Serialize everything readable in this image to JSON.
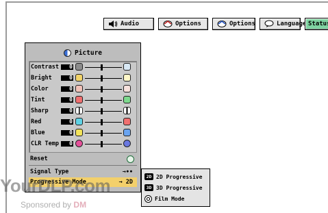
{
  "tabs": [
    {
      "label": "Audio",
      "icon": "speaker-icon",
      "active": false
    },
    {
      "label": "Options",
      "icon": "options-icon",
      "active": false
    },
    {
      "label": "Options",
      "icon": "options-icon",
      "active": false
    },
    {
      "label": "Language",
      "icon": "speech-bubble-icon",
      "active": false
    },
    {
      "label": "Status",
      "icon": "",
      "active": true
    }
  ],
  "panel": {
    "title": "Picture",
    "adjustments": [
      {
        "label": "Contrast",
        "value": "0",
        "left_color": "#8c8c8c",
        "right_color": "#d8e8f4"
      },
      {
        "label": "Bright",
        "value": "0",
        "left_color": "#f1d36a",
        "right_color": "#fff7c8"
      },
      {
        "label": "Color",
        "value": "0",
        "left_color": "#f1c2b8",
        "right_color": "#f7e1dc"
      },
      {
        "label": "Tint",
        "value": "0",
        "left_color": "#f07070",
        "right_color": "#7ed98e"
      },
      {
        "label": "Sharp",
        "value": "0",
        "left_color": "#ffffff",
        "right_color": "#ffffff"
      },
      {
        "label": "Red",
        "value": "0",
        "left_color": "#5fd3e6",
        "right_color": "#f07070"
      },
      {
        "label": "Blue",
        "value": "0",
        "left_color": "#f2e35a",
        "right_color": "#6aa4f0"
      },
      {
        "label": "CLR Temp",
        "value": "0",
        "left_color": "#e6509a",
        "right_color": "#6a78e0"
      }
    ],
    "reset_label": "Reset",
    "signal_type_label": "Signal Type",
    "signal_type_value": "→∙∙",
    "progressive_mode_label": "Progressive Mode",
    "progressive_mode_value": "→ 2D"
  },
  "submenu": [
    {
      "badge": "2D",
      "label": "2D Progressive"
    },
    {
      "badge": "3D",
      "label": "3D Progressive"
    },
    {
      "badge": "",
      "label": "Film Mode"
    }
  ],
  "watermark": {
    "brand": "YourDLP.com",
    "sponsor_prefix": "Sponsored by",
    "sponsor_name": "DM"
  }
}
